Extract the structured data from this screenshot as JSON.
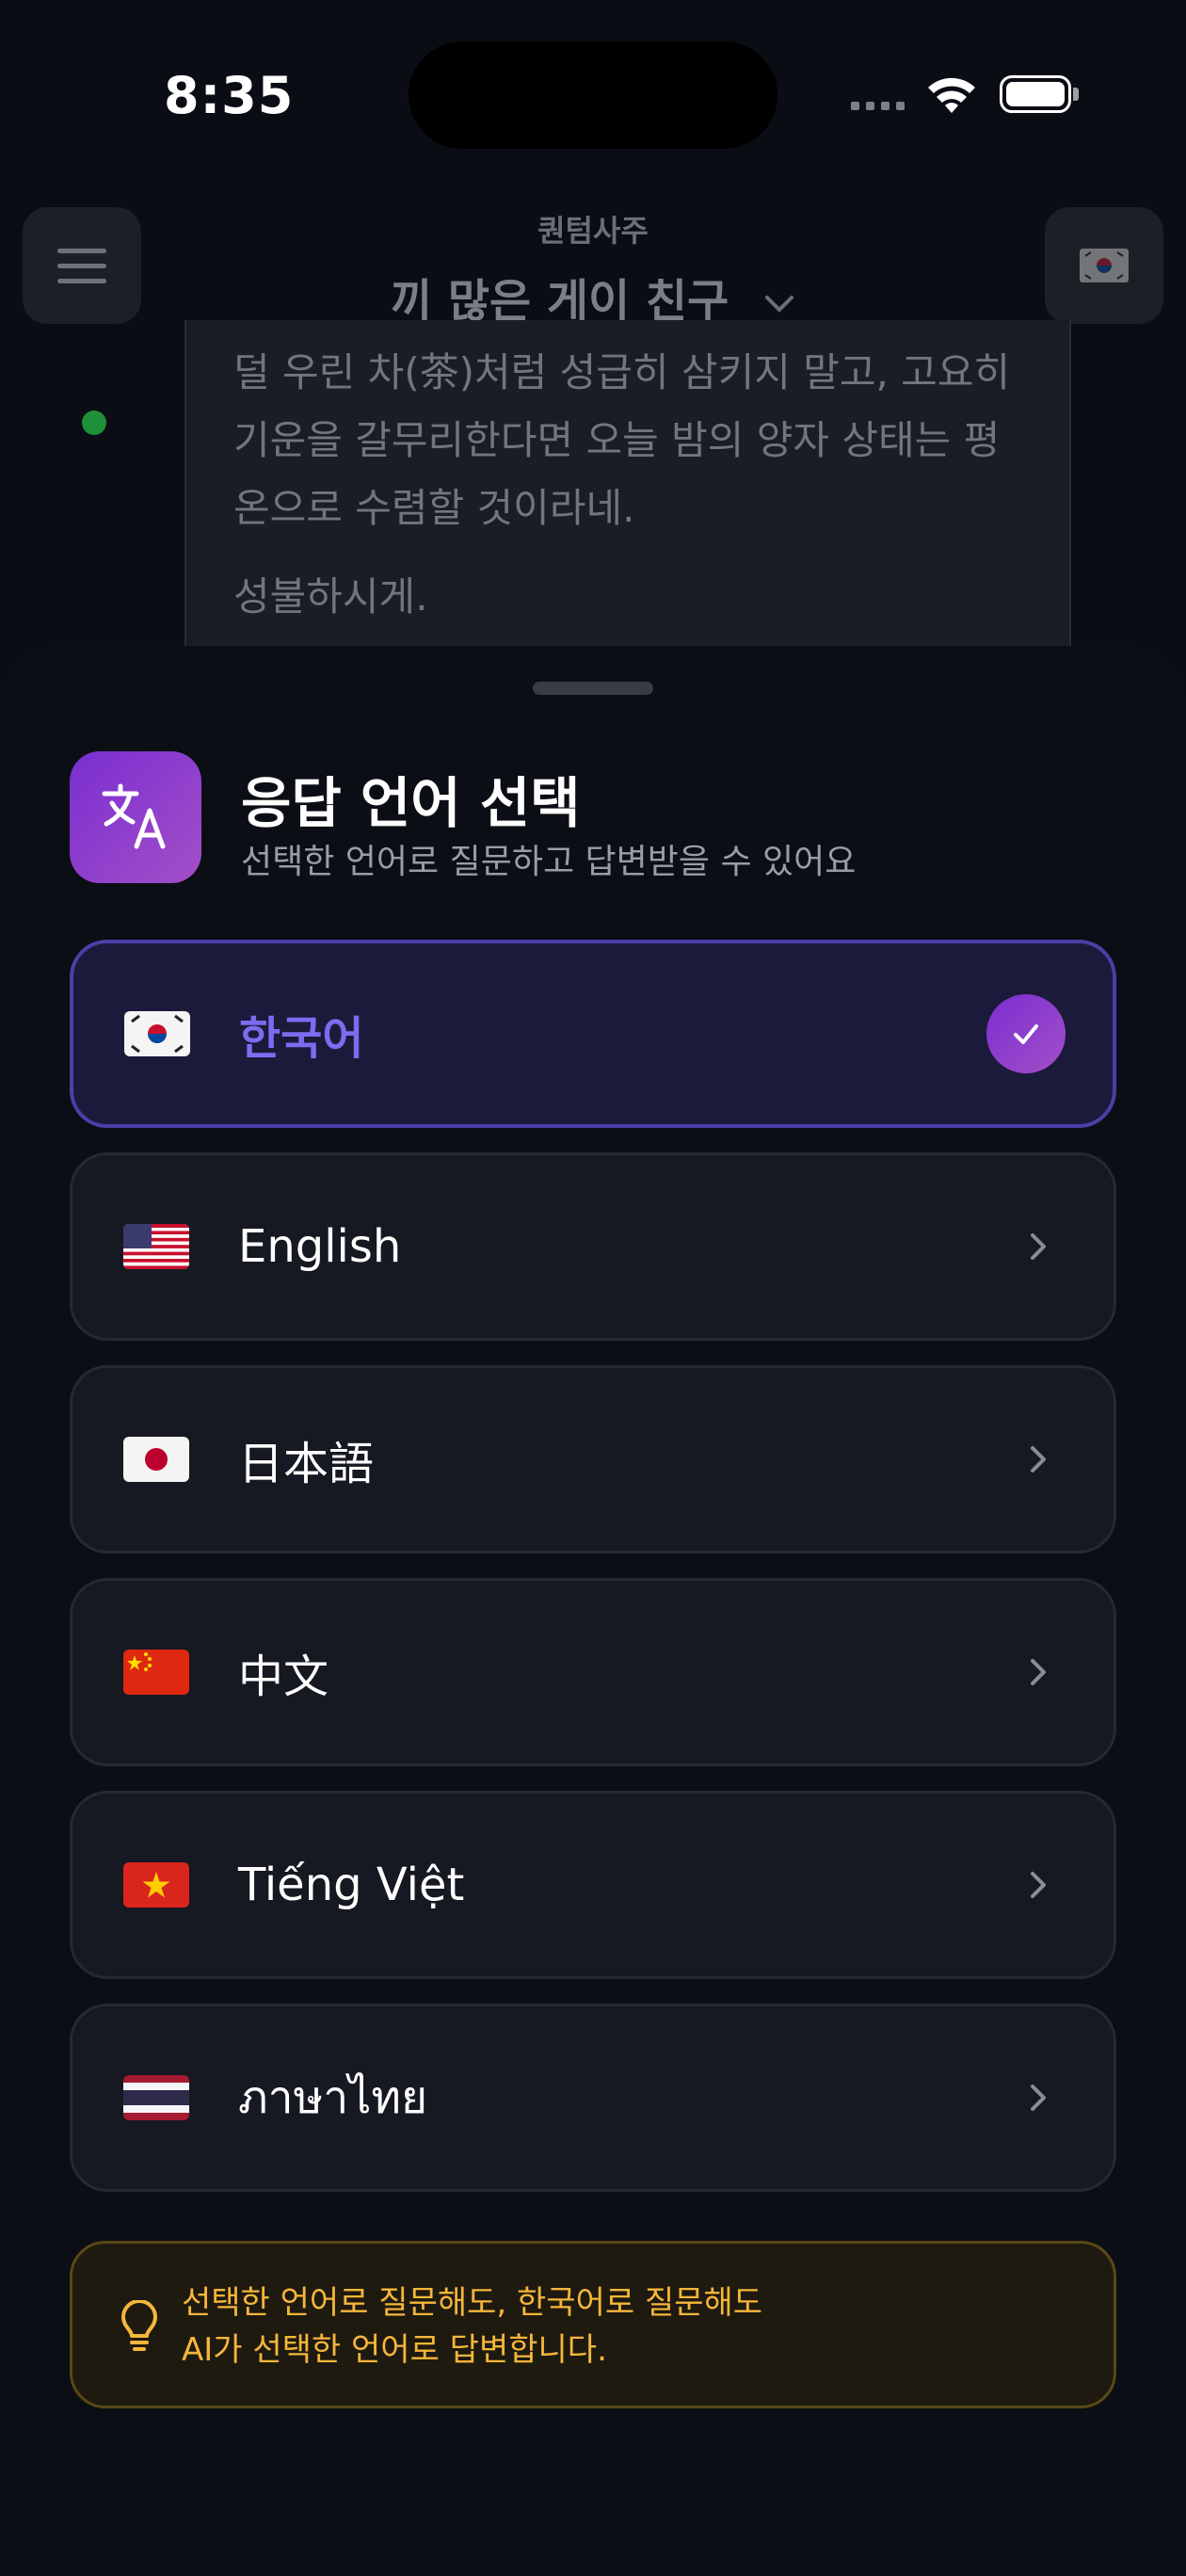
{
  "status_bar": {
    "time": "8:35"
  },
  "header": {
    "subtitle": "퀀텀사주",
    "title": "끼 많은 게이 친구"
  },
  "background_message": {
    "paragraph": "덜 우린 차(茶)처럼 성급히 삼키지 말고, 고요히 기운을 갈무리한다면 오늘 밤의 양자 상태는 평온으로 수렴할 것이라네.",
    "closing": "성불하시게."
  },
  "sheet": {
    "title": "응답 언어 선택",
    "subtitle": "선택한 언어로 질문하고 답변받을 수 있어요",
    "languages": [
      {
        "label": "한국어",
        "flag": "kr",
        "selected": true
      },
      {
        "label": "English",
        "flag": "us",
        "selected": false
      },
      {
        "label": "日本語",
        "flag": "jp",
        "selected": false
      },
      {
        "label": "中文",
        "flag": "cn",
        "selected": false
      },
      {
        "label": "Tiếng Việt",
        "flag": "vn",
        "selected": false
      },
      {
        "label": "ภาษาไทย",
        "flag": "th",
        "selected": false
      }
    ],
    "tip_line1": "선택한 언어로 질문해도, 한국어로 질문해도",
    "tip_line2": "AI가 선택한 언어로 답변합니다."
  },
  "colors": {
    "background": "#0b0d14",
    "accent_purple": "#7b6cf0",
    "selected_border": "#4b3fa8",
    "tip_text": "#f5b63a",
    "online": "#1f8f3a"
  },
  "icons": [
    "menu-icon",
    "korea-flag-icon",
    "chevron-down-icon",
    "translate-icon",
    "check-icon",
    "chevron-right-icon",
    "lightbulb-icon",
    "wifi-icon",
    "battery-icon"
  ]
}
